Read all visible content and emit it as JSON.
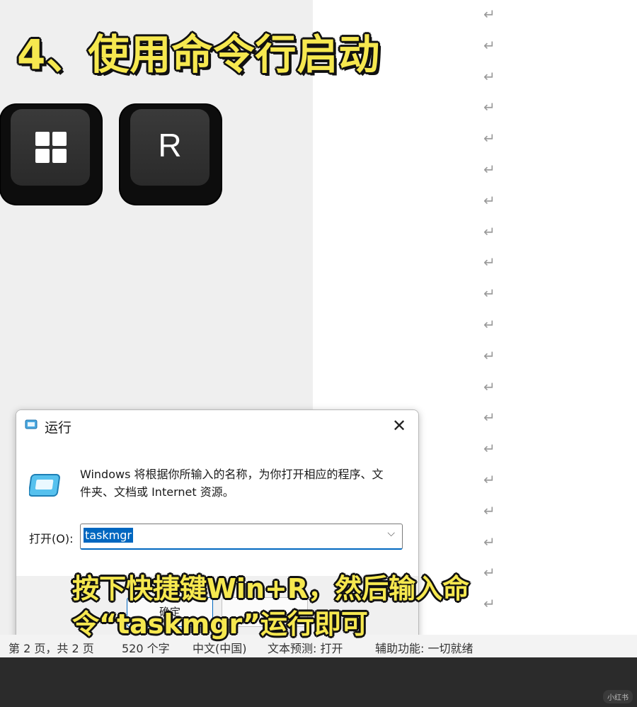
{
  "heading": "4、使用命令行启动",
  "keys": {
    "win_icon": "windows-logo-icon",
    "r_label": "R"
  },
  "paragraph_mark": "↵",
  "dialog": {
    "title": "运行",
    "close_icon": "close-icon",
    "close_glyph": "✕",
    "description": "Windows 将根据你所输入的名称，为你打开相应的程序、文件夹、文档或 Internet 资源。",
    "open_label": "打开(O):",
    "open_value": "taskmgr",
    "dropdown_glyph": "⌵",
    "ok_label": "确定"
  },
  "status_bar": {
    "page": "第 2 页，共 2 页",
    "words": "520 个字",
    "language": "中文(中国)",
    "prediction": "文本预测: 打开",
    "accessibility": "辅助功能: 一切就绪"
  },
  "caption": {
    "line1": "按下快捷键Win+R，然后输入命",
    "line2": "令“taskmgr”运行即可"
  },
  "watermark": "小红书"
}
